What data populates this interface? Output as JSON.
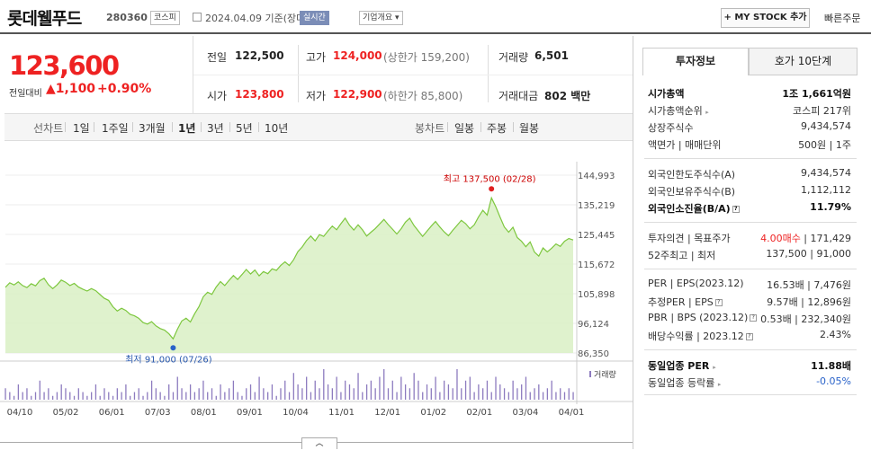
{
  "header": {
    "company": "롯데웰푸드",
    "code": "280360",
    "market": "코스피",
    "date": "2024.04.09 기준(장마감)",
    "realtime": "실시간",
    "overview": "기업개요",
    "mystock": "+ MY STOCK 추가",
    "quick_order": "빠른주문"
  },
  "quote": {
    "price": "123,600",
    "change_label": "전일대비",
    "change": "▲1,100",
    "change_pct": "+0.90%",
    "prev_close_label": "전일",
    "prev_close": "122,500",
    "high_label": "고가",
    "high": "124,000",
    "upper_limit": "(상한가 159,200)",
    "volume_label": "거래량",
    "volume": "6,501",
    "open_label": "시가",
    "open": "123,800",
    "low_label": "저가",
    "low": "122,900",
    "lower_limit": "(하한가 85,800)",
    "amount_label": "거래대금",
    "amount": "802",
    "amount_unit": "백만"
  },
  "periods": {
    "line_label": "선차트",
    "items": [
      "1일",
      "1주일",
      "3개월",
      "1년",
      "3년",
      "5년",
      "10년"
    ],
    "active": "1년",
    "candle_label": "봉차트",
    "candle_items": [
      "일봉",
      "주봉",
      "월봉"
    ]
  },
  "chart_data": {
    "type": "area",
    "y_ticks": [
      "144,993",
      "135,219",
      "125,445",
      "115,672",
      "105,898",
      "96,124",
      "86,350"
    ],
    "ylim": [
      86350,
      144993
    ],
    "x_ticks": [
      "04/10",
      "05/02",
      "06/01",
      "07/03",
      "08/01",
      "09/01",
      "10/04",
      "11/01",
      "12/01",
      "01/02",
      "02/01",
      "03/04",
      "04/01"
    ],
    "max_label": "최고 137,500 (02/28)",
    "min_label": "최저 91,000 (07/26)",
    "max": 137500,
    "min": 91000,
    "volume_label": "거래량",
    "line_color": "#7dc73e",
    "fill_color": "#d9f0c4",
    "prices": [
      108000,
      109500,
      108800,
      109800,
      108600,
      107900,
      109200,
      108500,
      110200,
      111000,
      108900,
      107600,
      108800,
      110400,
      109700,
      108600,
      109300,
      108100,
      107400,
      106800,
      107600,
      106900,
      105600,
      104400,
      103700,
      101600,
      100200,
      101100,
      100400,
      99100,
      98600,
      97800,
      96400,
      95900,
      96700,
      95300,
      94400,
      93900,
      92700,
      91000,
      94200,
      96900,
      97800,
      96600,
      99300,
      101600,
      104900,
      106400,
      105700,
      108100,
      109900,
      108600,
      110300,
      111900,
      110600,
      112200,
      113900,
      112400,
      113700,
      111800,
      113200,
      112500,
      114100,
      113600,
      115200,
      116400,
      115200,
      117100,
      119800,
      121300,
      123400,
      124900,
      123300,
      125400,
      124800,
      126600,
      128200,
      127000,
      129000,
      130800,
      128500,
      126900,
      128600,
      127000,
      124900,
      126200,
      127400,
      128900,
      130400,
      128700,
      127200,
      125600,
      127300,
      129500,
      130800,
      128400,
      126600,
      124800,
      126500,
      128200,
      129700,
      127900,
      126300,
      125000,
      126800,
      128400,
      130100,
      129000,
      127300,
      128600,
      131200,
      133400,
      131800,
      137500,
      134600,
      131200,
      127900,
      126200,
      127800,
      124400,
      123200,
      121400,
      123000,
      119600,
      118300,
      121000,
      119700,
      120900,
      122300,
      121500,
      123200,
      124100,
      123600
    ],
    "volumes": [
      3,
      2,
      1,
      4,
      2,
      3,
      1,
      2,
      5,
      2,
      3,
      1,
      2,
      4,
      3,
      2,
      1,
      3,
      2,
      1,
      2,
      4,
      1,
      3,
      2,
      1,
      3,
      2,
      4,
      1,
      2,
      3,
      1,
      2,
      5,
      3,
      2,
      1,
      4,
      2,
      6,
      3,
      2,
      4,
      2,
      3,
      5,
      2,
      3,
      1,
      4,
      2,
      3,
      5,
      2,
      1,
      3,
      4,
      2,
      6,
      3,
      2,
      4,
      1,
      3,
      5,
      2,
      7,
      4,
      3,
      6,
      2,
      5,
      3,
      8,
      4,
      3,
      6,
      2,
      5,
      4,
      3,
      7,
      2,
      4,
      5,
      3,
      6,
      8,
      3,
      5,
      2,
      6,
      4,
      3,
      7,
      5,
      2,
      4,
      3,
      6,
      2,
      5,
      4,
      3,
      8,
      3,
      5,
      6,
      2,
      4,
      3,
      5,
      2,
      6,
      4,
      3,
      2,
      5,
      3,
      4,
      6,
      2,
      3,
      4,
      2,
      3,
      5,
      2,
      3,
      2,
      3,
      2
    ]
  },
  "right_panel": {
    "tabs": [
      "투자정보",
      "호가 10단계"
    ],
    "rows": [
      {
        "label": "시가총액",
        "value": "1조 1,661억원",
        "bold": true
      },
      {
        "label": "시가총액순위",
        "value": "코스피 217위"
      },
      {
        "label": "상장주식수",
        "value": "9,434,574"
      },
      {
        "label": "액면가 | 매매단위",
        "value": "500원 | 1주"
      },
      {
        "label": "외국인한도주식수(A)",
        "value": "9,434,574"
      },
      {
        "label": "외국인보유주식수(B)",
        "value": "1,112,112"
      },
      {
        "label": "외국인소진율(B/A)",
        "value": "11.79%",
        "bold": true
      },
      {
        "label": "투자의견 | 목표주가",
        "value_red": "4.00매수",
        "value": " | 171,429"
      },
      {
        "label": "52주최고 | 최저",
        "value": "137,500 | 91,000"
      },
      {
        "label": "PER | EPS(2023.12)",
        "value": "16.53배 | 7,476원"
      },
      {
        "label": "추정PER | EPS",
        "value": "9.57배 | 12,896원"
      },
      {
        "label": "PBR | BPS (2023.12)",
        "value": "0.53배 | 232,340원"
      },
      {
        "label": "배당수익률 | 2023.12",
        "value": "2.43%"
      },
      {
        "label": "동일업종 PER",
        "value": "11.88배",
        "bold": true
      },
      {
        "label": "동일업종 등락률",
        "value": "-0.05%"
      }
    ]
  }
}
